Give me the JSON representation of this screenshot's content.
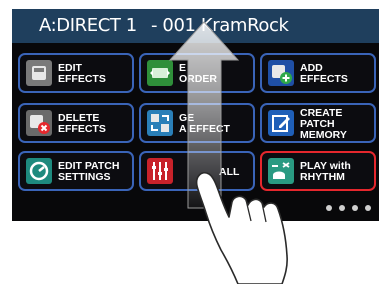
{
  "titlebar": {
    "patch_id": "A:DIRECT 1",
    "patch_name": "- 001 KramRock"
  },
  "menu": [
    {
      "label": "EDIT\nEFFECTS",
      "icon": "edit-effects-icon",
      "color": "#7a7a7a"
    },
    {
      "label": "E\nORDER",
      "icon": "change-effect-order-icon",
      "color": "#2f8f3a"
    },
    {
      "label": "ADD\nEFFECTS",
      "icon": "add-effects-icon",
      "color": "#1f4fa5"
    },
    {
      "label": "DELETE\nEFFECTS",
      "icon": "delete-effects-icon",
      "color": "#6a6a6a"
    },
    {
      "label": "GE\nA EFFECT",
      "icon": "change-effect-icon",
      "color": "#2a7fb8"
    },
    {
      "label": "CREATE PATCH\nMEMORY",
      "icon": "create-patch-memory-icon",
      "color": "#1f5fb8"
    },
    {
      "label": "EDIT PATCH\nSETTINGS",
      "icon": "edit-patch-settings-icon",
      "color": "#1e8a7e"
    },
    {
      "label": "ALL",
      "icon": "mixer-all-icon",
      "color": "#c8222a"
    },
    {
      "label": "PLAY with\nRHYTHM",
      "icon": "play-with-rhythm-icon",
      "color": "#2a9a82"
    }
  ],
  "colors": {
    "titlebar": "#1f3f5d",
    "tile_border": "#3a64b8",
    "highlight_border": "#e5272d"
  },
  "gesture": {
    "type": "swipe-up"
  }
}
